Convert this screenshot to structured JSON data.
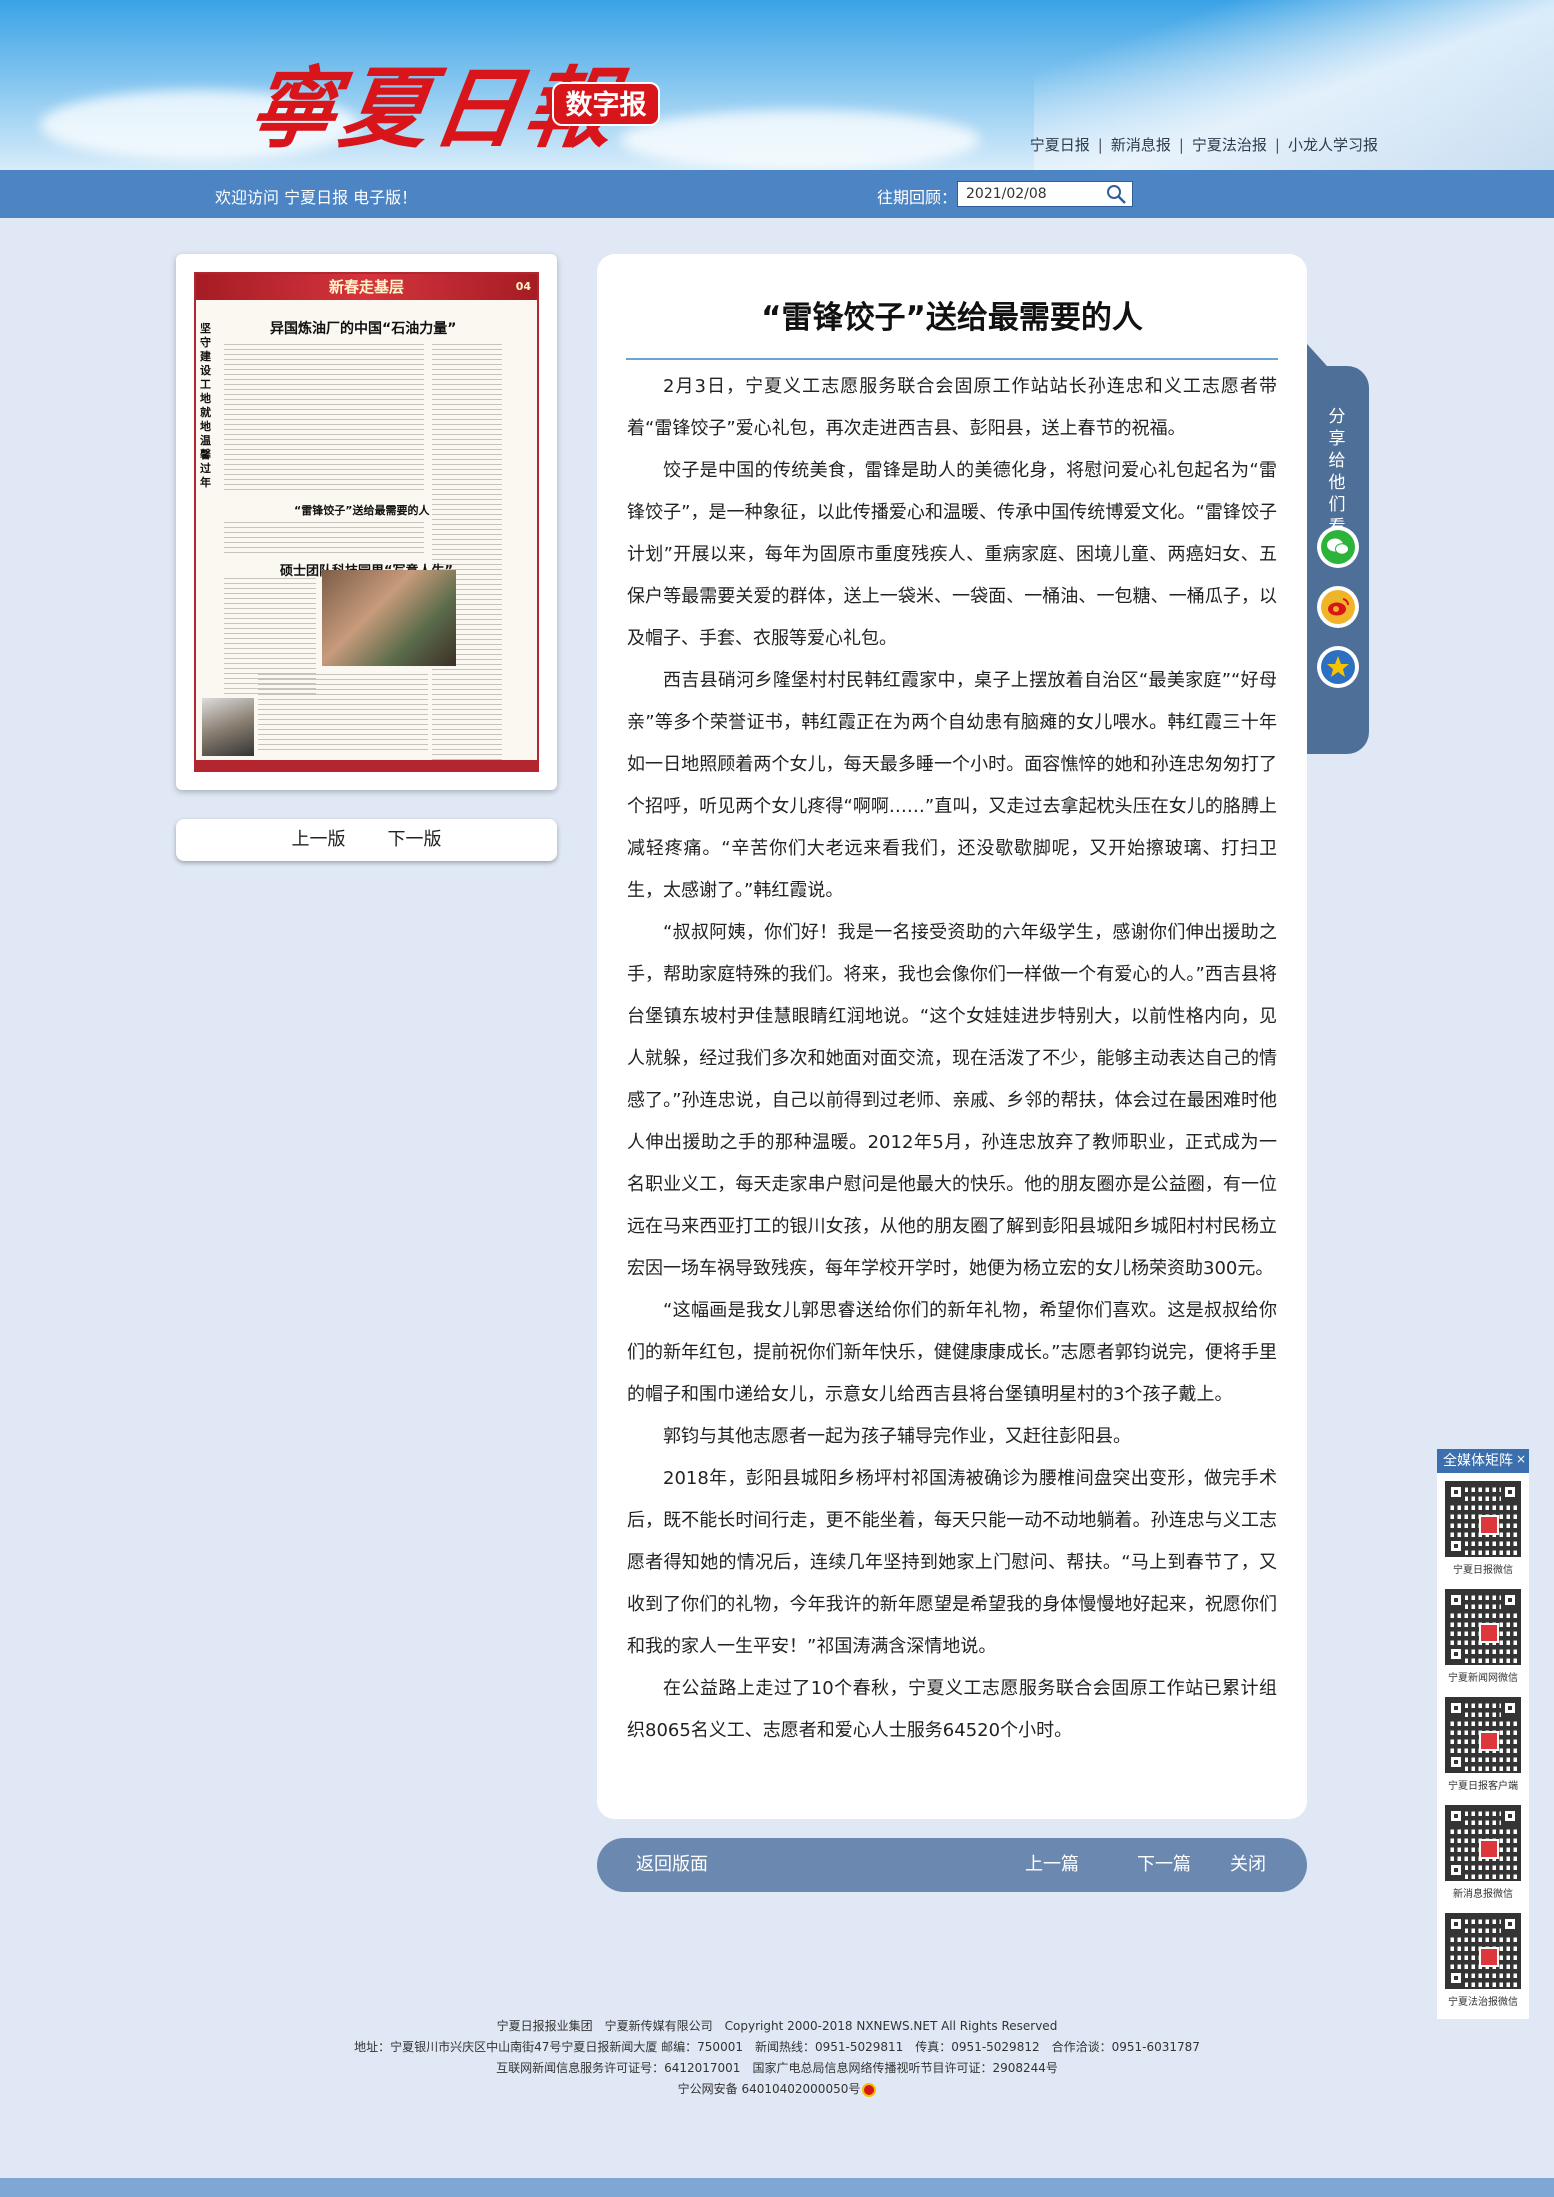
{
  "header": {
    "logo_text": "寧夏日報",
    "digital_badge": "数字报",
    "links": [
      "宁夏日报",
      "新消息报",
      "宁夏法治报",
      "小龙人学习报"
    ]
  },
  "nav_bar": {
    "welcome": "欢迎访问 宁夏日报 电子版！",
    "archive_label": "往期回顾：",
    "date_value": "2021/02/08",
    "search_icon": "search-icon"
  },
  "page_thumb": {
    "banner": "新春走基层",
    "page_no": "04",
    "headline_1": "异国炼油厂的中国“石油力量”",
    "headline_2": "“雷锋饺子”送给最需要的人",
    "headline_3": "硕士团队科技园里“写意人生”",
    "side_headline": "坚守建设工地  就地温馨过年"
  },
  "page_nav": {
    "prev": "上一版",
    "next": "下一版"
  },
  "article": {
    "title": "“雷锋饺子”送给最需要的人",
    "paragraphs": [
      "2月3日，宁夏义工志愿服务联合会固原工作站站长孙连忠和义工志愿者带着“雷锋饺子”爱心礼包，再次走进西吉县、彭阳县，送上春节的祝福。",
      "饺子是中国的传统美食，雷锋是助人的美德化身，将慰问爱心礼包起名为“雷锋饺子”，是一种象征，以此传播爱心和温暖、传承中国传统博爱文化。“雷锋饺子计划”开展以来，每年为固原市重度残疾人、重病家庭、困境儿童、两癌妇女、五保户等最需要关爱的群体，送上一袋米、一袋面、一桶油、一包糖、一桶瓜子，以及帽子、手套、衣服等爱心礼包。",
      "西吉县硝河乡隆堡村村民韩红霞家中，桌子上摆放着自治区“最美家庭”“好母亲”等多个荣誉证书，韩红霞正在为两个自幼患有脑瘫的女儿喂水。韩红霞三十年如一日地照顾着两个女儿，每天最多睡一个小时。面容憔悴的她和孙连忠匆匆打了个招呼，听见两个女儿疼得“啊啊……”直叫，又走过去拿起枕头压在女儿的胳膊上减轻疼痛。“辛苦你们大老远来看我们，还没歇歇脚呢，又开始擦玻璃、打扫卫生，太感谢了。”韩红霞说。",
      "“叔叔阿姨，你们好！我是一名接受资助的六年级学生，感谢你们伸出援助之手，帮助家庭特殊的我们。将来，我也会像你们一样做一个有爱心的人。”西吉县将台堡镇东坡村尹佳慧眼睛红润地说。“这个女娃娃进步特别大，以前性格内向，见人就躲，经过我们多次和她面对面交流，现在活泼了不少，能够主动表达自己的情感了。”孙连忠说，自己以前得到过老师、亲戚、乡邻的帮扶，体会过在最困难时他人伸出援助之手的那种温暖。2012年5月，孙连忠放弃了教师职业，正式成为一名职业义工，每天走家串户慰问是他最大的快乐。他的朋友圈亦是公益圈，有一位远在马来西亚打工的银川女孩，从他的朋友圈了解到彭阳县城阳乡城阳村村民杨立宏因一场车祸导致残疾，每年学校开学时，她便为杨立宏的女儿杨荣资助300元。",
      "“这幅画是我女儿郭思睿送给你们的新年礼物，希望你们喜欢。这是叔叔给你们的新年红包，提前祝你们新年快乐，健健康康成长。”志愿者郭钧说完，便将手里的帽子和围巾递给女儿，示意女儿给西吉县将台堡镇明星村的3个孩子戴上。",
      "郭钧与其他志愿者一起为孩子辅导完作业，又赶往彭阳县。",
      "2018年，彭阳县城阳乡杨坪村祁国涛被确诊为腰椎间盘突出变形，做完手术后，既不能长时间行走，更不能坐着，每天只能一动不动地躺着。孙连忠与义工志愿者得知她的情况后，连续几年坚持到她家上门慰问、帮扶。“马上到春节了，又收到了你们的礼物，今年我许的新年愿望是希望我的身体慢慢地好起来，祝愿你们和我的家人一生平安！”祁国涛满含深情地说。",
      "在公益路上走过了10个春秋，宁夏义工志愿服务联合会固原工作站已累计组织8065名义工、志愿者和爱心人士服务64520个小时。"
    ]
  },
  "share": {
    "label": "分享给他们看看",
    "buttons": [
      {
        "name": "wechat-icon",
        "color": "#2bb33a"
      },
      {
        "name": "weibo-icon",
        "color": "#f0b429"
      },
      {
        "name": "favorite-star-icon",
        "color": "#2d6fc0"
      }
    ]
  },
  "article_nav": {
    "back": "返回版面",
    "prev": "上一篇",
    "next": "下一篇",
    "close": "关闭"
  },
  "media_matrix": {
    "title": "全媒体矩阵",
    "close": "×",
    "items": [
      "宁夏日报微信",
      "宁夏新闻网微信",
      "宁夏日报客户端",
      "新消息报微信",
      "宁夏法治报微信"
    ]
  },
  "footer": {
    "line1": "宁夏日报报业集团　宁夏新传媒有限公司　Copyright 2000-2018 NXNEWS.NET All Rights Reserved",
    "line2": "地址：宁夏银川市兴庆区中山南街47号宁夏日报新闻大厦 邮编：750001　新闻热线：0951-5029811　传真：0951-5029812　合作洽谈：0951-6031787",
    "line3": "互联网新闻信息服务许可证号：6412017001　国家广电总局信息网络传播视听节目许可证：2908244号",
    "line4": "宁公网安备 64010402000050号"
  }
}
